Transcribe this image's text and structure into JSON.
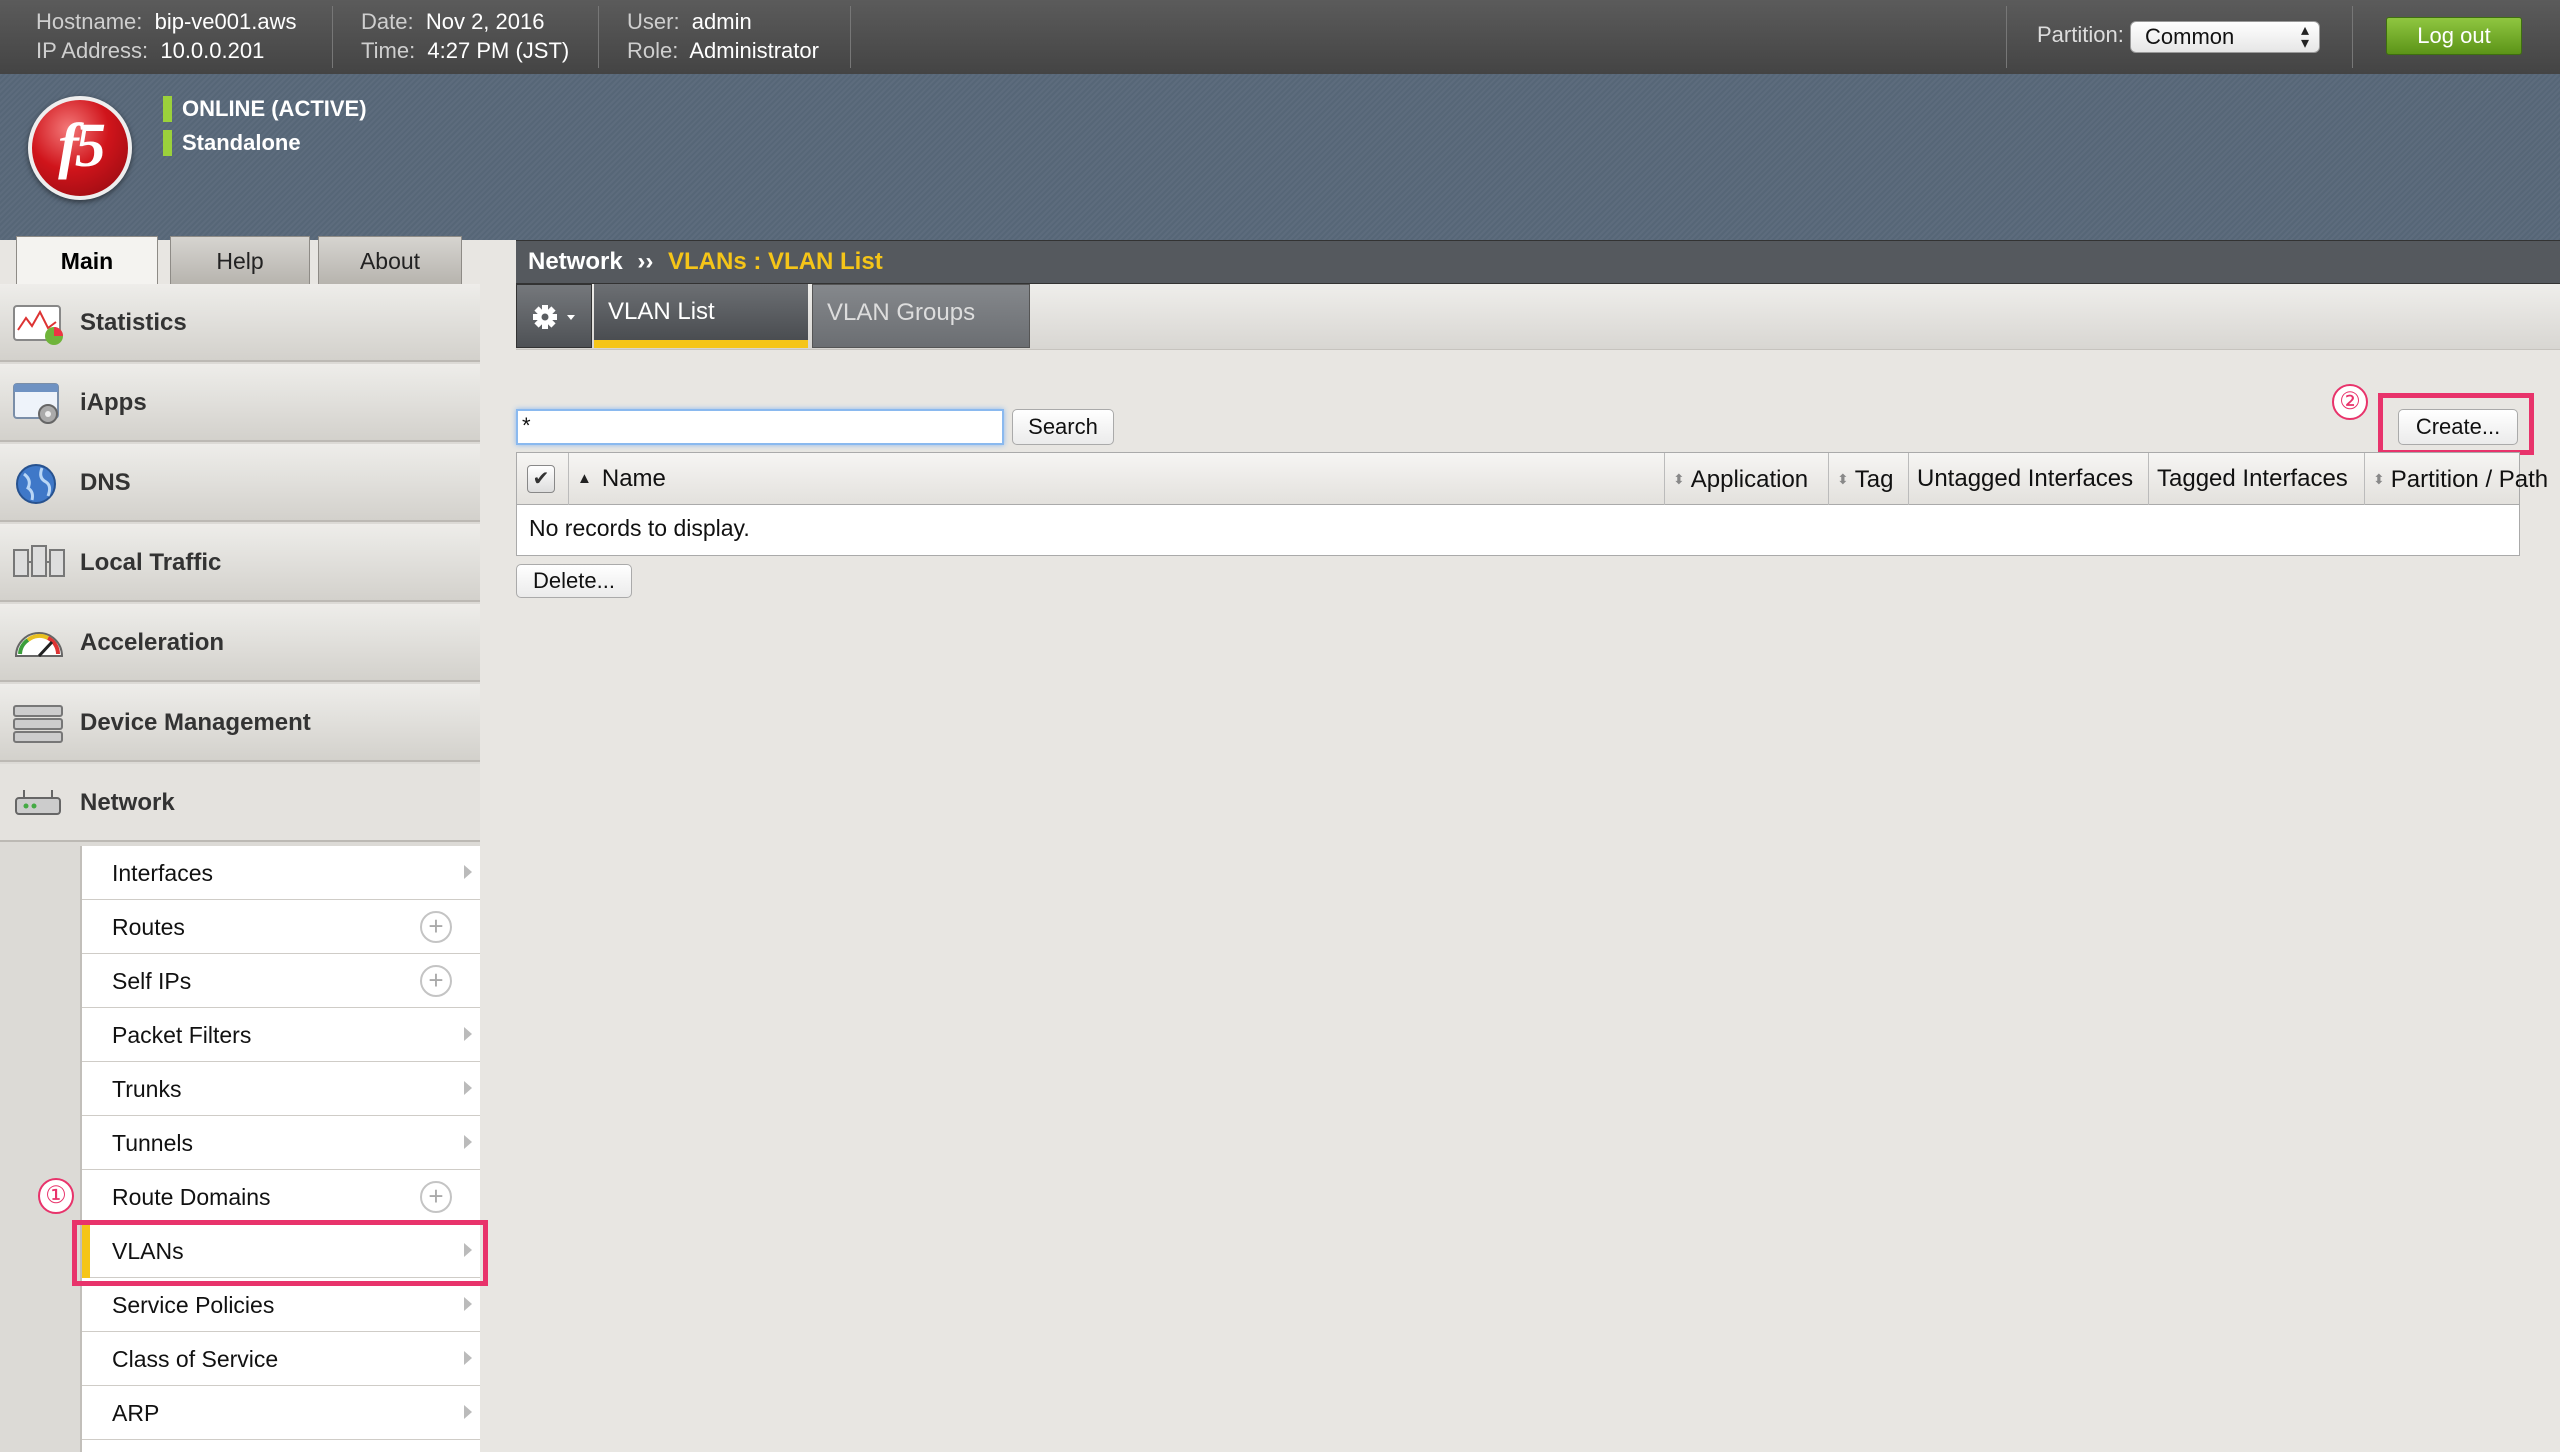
{
  "topbar": {
    "hostname_label": "Hostname:",
    "hostname": "bip-ve001.aws",
    "ip_label": "IP Address:",
    "ip": "10.0.0.201",
    "date_label": "Date:",
    "date": "Nov 2, 2016",
    "time_label": "Time:",
    "time": "4:27 PM (JST)",
    "user_label": "User:",
    "user": "admin",
    "role_label": "Role:",
    "role": "Administrator",
    "partition_label": "Partition:",
    "partition_value": "Common",
    "logout_label": "Log out"
  },
  "header": {
    "logo_text": "f5",
    "status_primary": "ONLINE (ACTIVE)",
    "status_secondary": "Standalone"
  },
  "main_tabs": [
    {
      "label": "Main",
      "active": true
    },
    {
      "label": "Help",
      "active": false
    },
    {
      "label": "About",
      "active": false
    }
  ],
  "sidebar": {
    "items": [
      {
        "label": "Statistics",
        "icon": "statistics-icon"
      },
      {
        "label": "iApps",
        "icon": "iapps-icon"
      },
      {
        "label": "DNS",
        "icon": "dns-globe-icon"
      },
      {
        "label": "Local Traffic",
        "icon": "local-traffic-icon"
      },
      {
        "label": "Acceleration",
        "icon": "speedometer-icon"
      },
      {
        "label": "Device Management",
        "icon": "server-stack-icon"
      },
      {
        "label": "Network",
        "icon": "network-device-icon",
        "expanded": true
      }
    ],
    "network_subitems": [
      {
        "label": "Interfaces",
        "affordance": "chevron"
      },
      {
        "label": "Routes",
        "affordance": "plus"
      },
      {
        "label": "Self IPs",
        "affordance": "plus"
      },
      {
        "label": "Packet Filters",
        "affordance": "chevron"
      },
      {
        "label": "Trunks",
        "affordance": "chevron"
      },
      {
        "label": "Tunnels",
        "affordance": "chevron"
      },
      {
        "label": "Route Domains",
        "affordance": "plus"
      },
      {
        "label": "VLANs",
        "affordance": "chevron",
        "active": true
      },
      {
        "label": "Service Policies",
        "affordance": "chevron"
      },
      {
        "label": "Class of Service",
        "affordance": "chevron"
      },
      {
        "label": "ARP",
        "affordance": "chevron"
      }
    ]
  },
  "annotations": {
    "step1": "①",
    "step2": "②",
    "highlight_color": "#e8336b"
  },
  "breadcrumb": {
    "root": "Network",
    "separator": "››",
    "current": "VLANs : VLAN List"
  },
  "subtabs": [
    {
      "label": "VLAN List",
      "active": true
    },
    {
      "label": "VLAN Groups",
      "active": false
    }
  ],
  "search": {
    "value": "*",
    "button_label": "Search"
  },
  "create_button_label": "Create...",
  "table": {
    "columns": [
      "Name",
      "Application",
      "Tag",
      "Untagged Interfaces",
      "Tagged Interfaces",
      "Partition / Path"
    ],
    "empty_message": "No records to display."
  },
  "delete_button_label": "Delete...",
  "colors": {
    "accent_yellow": "#f5c518",
    "status_green": "#9bd13b",
    "logout_green": "#6ea62a",
    "f5_red": "#d0141b"
  }
}
